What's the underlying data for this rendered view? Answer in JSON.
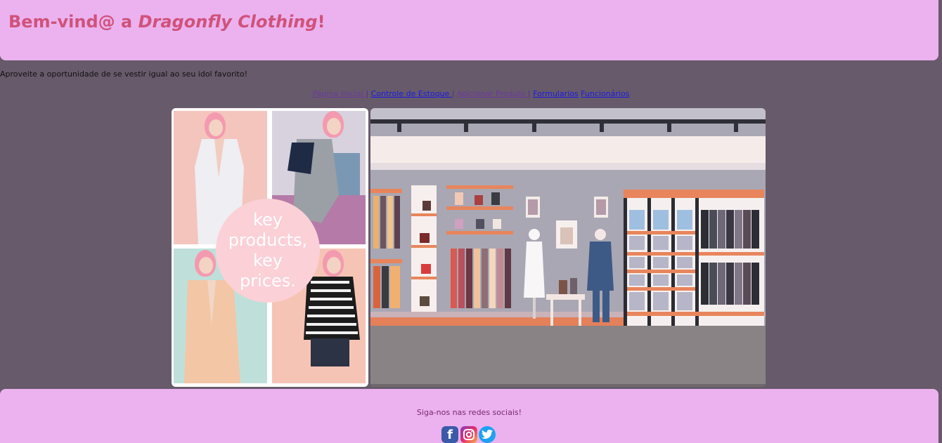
{
  "header": {
    "title_prefix": "Bem-vind@ a ",
    "brand_name": "Dragonfly Clothing",
    "title_suffix": "!"
  },
  "tagline": "Aproveite a oportunidade de se vestir igual ao seu idol favorito!",
  "nav": {
    "items": [
      {
        "label": "Página Inicial "
      },
      {
        "label": "Controle de Estoque "
      },
      {
        "label": "Adicionar Produto "
      },
      {
        "label": "Formularios"
      },
      {
        "label": "Funcionários"
      }
    ],
    "separator": "|"
  },
  "promo": {
    "badge_text": "key\nproducts,\nkey\nprices."
  },
  "footer": {
    "follow_text": "Siga-nos nas redes sociais!",
    "social": [
      "facebook-icon",
      "instagram-icon",
      "twitter-icon"
    ]
  },
  "colors": {
    "background": "#675a6a",
    "header_bg": "#ebb2ef",
    "title": "#d0527a"
  }
}
